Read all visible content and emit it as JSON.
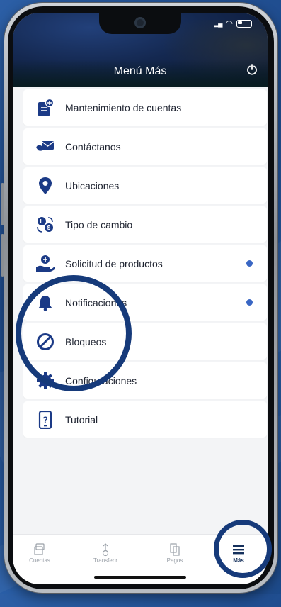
{
  "header": {
    "title": "Menú Más"
  },
  "menu": {
    "items": [
      {
        "label": "Mantenimiento de cuentas"
      },
      {
        "label": "Contáctanos"
      },
      {
        "label": "Ubicaciones"
      },
      {
        "label": "Tipo de cambio"
      },
      {
        "label": "Solicitud de productos"
      },
      {
        "label": "Notificaciones"
      },
      {
        "label": "Bloqueos"
      },
      {
        "label": "Configuraciones"
      },
      {
        "label": "Tutorial"
      }
    ]
  },
  "tabbar": {
    "tabs": [
      {
        "label": "Cuentas"
      },
      {
        "label": "Transferir"
      },
      {
        "label": "Pagos"
      },
      {
        "label": "Más"
      }
    ]
  },
  "colors": {
    "accent": "#1b3a86",
    "header": "#142850",
    "dot": "#3a67c4",
    "highlight_ring": "#163a7a"
  },
  "icons": [
    "account-doc-icon",
    "envelope-hand-icon",
    "location-pin-icon",
    "currency-exchange-icon",
    "hand-plus-icon",
    "bell-icon",
    "block-icon",
    "gear-icon",
    "tutorial-phone-icon",
    "power-icon",
    "hamburger-icon"
  ]
}
